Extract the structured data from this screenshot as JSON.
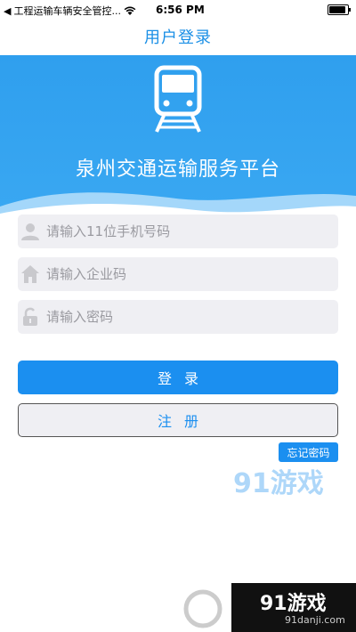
{
  "status_bar": {
    "carrier": "工程运输车辆安全管控...",
    "time": "6:56 PM"
  },
  "nav": {
    "title": "用户登录"
  },
  "header": {
    "platform_name": "泉州交通运输服务平台"
  },
  "form": {
    "phone_placeholder": "请输入11位手机号码",
    "company_placeholder": "请输入企业码",
    "password_placeholder": "请输入密码"
  },
  "buttons": {
    "login": "登录",
    "register": "注册",
    "forgot_password": "忘记密码"
  },
  "watermark": {
    "logo_text": "91游戏",
    "site": "91danji.com"
  },
  "colors": {
    "accent": "#1b8ff0",
    "banner": "#2f9fee",
    "input_bg": "#efeff3"
  }
}
